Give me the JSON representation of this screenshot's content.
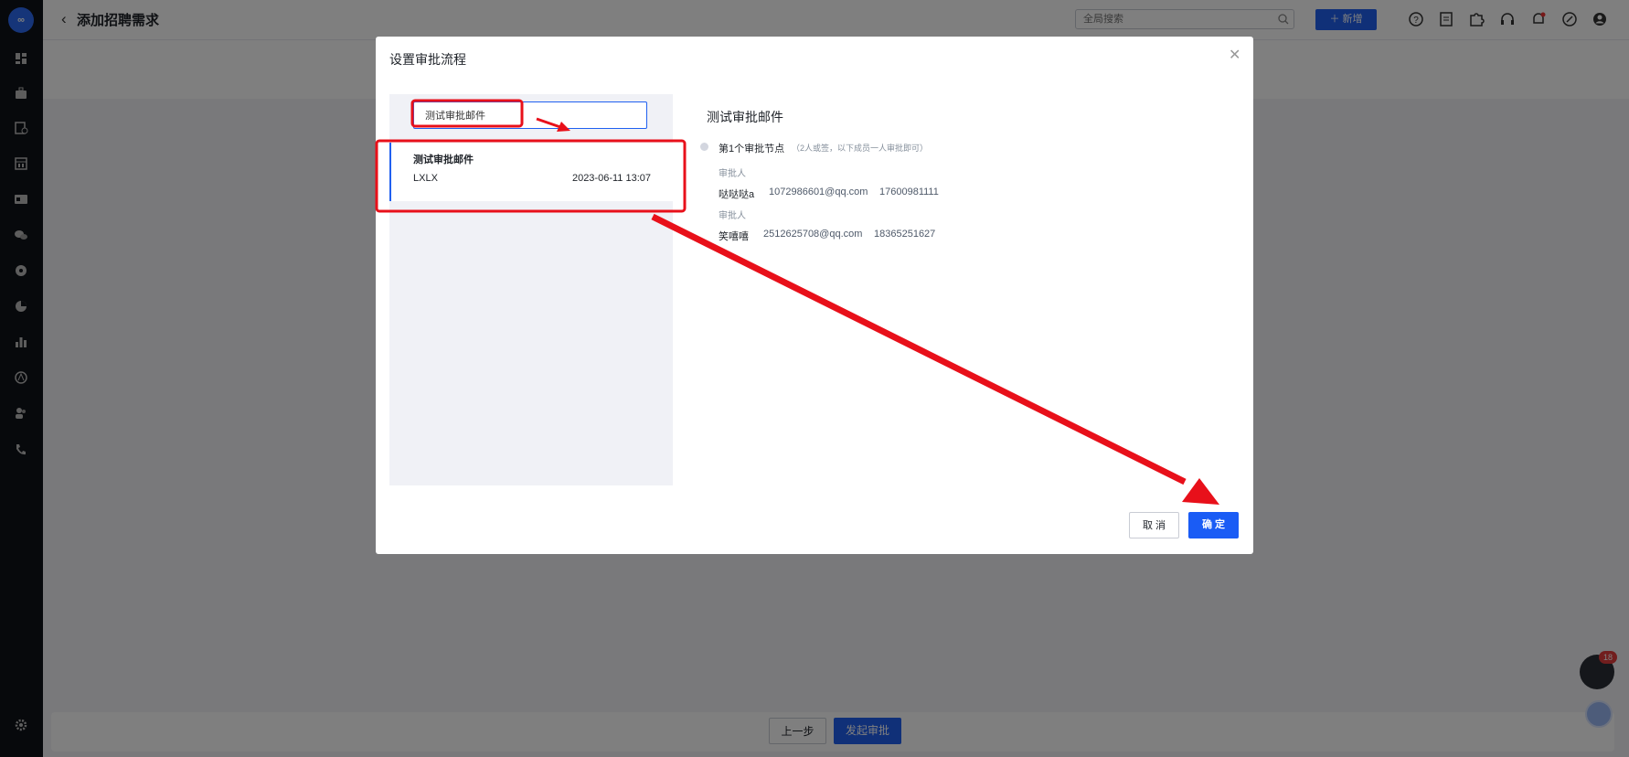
{
  "header": {
    "back_icon": "chevron-left-icon",
    "title": "添加招聘需求",
    "global_search_placeholder": "全局搜索",
    "new_button": "新增",
    "new_icon": "plus-icon",
    "icons": [
      "help-icon",
      "document-icon",
      "puzzle-icon",
      "headset-icon",
      "bell-icon",
      "link-icon",
      "user-icon"
    ]
  },
  "sidebar": {
    "logo_text": "∞",
    "icons": [
      "dashboard-icon",
      "briefcase-icon",
      "document-clock-icon",
      "calendar-grid-icon",
      "id-card-icon",
      "wechat-icon",
      "gauge-icon",
      "pie-chart-icon",
      "bar-chart-icon",
      "approval-icon",
      "team-icon",
      "phone-icon",
      "settings-icon"
    ]
  },
  "footer": {
    "prev_button": "上一步",
    "submit_button": "发起审批"
  },
  "chat": {
    "badge_count": "18"
  },
  "modal": {
    "title": "设置审批流程",
    "close_icon": "close-icon",
    "search_value": "测试审批邮件",
    "templates": [
      {
        "name": "测试审批邮件",
        "code": "LXLX",
        "date": "2023-06-11 13:07"
      }
    ],
    "detail": {
      "title": "测试审批邮件",
      "node_title": "第1个审批节点",
      "node_note": "（2人或签，以下成员一人审批即可）",
      "approvers": [
        {
          "label": "审批人",
          "name": "哒哒哒a",
          "email": "1072986601@qq.com",
          "phone": "17600981111"
        },
        {
          "label": "审批人",
          "name": "笑嘻嘻",
          "email": "2512625708@qq.com",
          "phone": "18365251627"
        }
      ]
    },
    "cancel_button": "取 消",
    "ok_button": "确 定"
  },
  "colors": {
    "primary": "#2060f0",
    "annotation": "#e8101a",
    "sidebar": "#0f1219"
  }
}
